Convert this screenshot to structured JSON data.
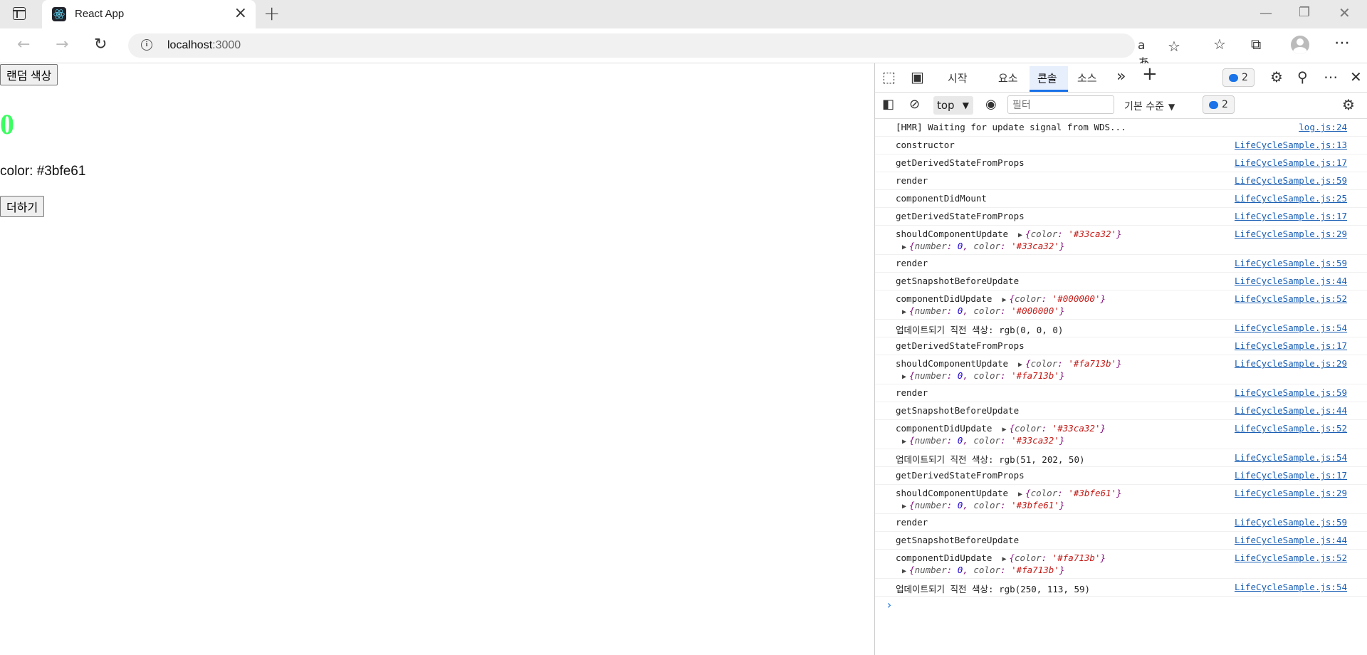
{
  "browser": {
    "tab_title": "React App",
    "url_host": "localhost",
    "url_port": ":3000"
  },
  "page": {
    "random_color_button": "랜덤 색상",
    "counter_value": "0",
    "counter_color": "#3bfe61",
    "color_label": "color: #3bfe61",
    "add_button": "더하기"
  },
  "devtools": {
    "tabs": [
      "시작",
      "요소",
      "콘솔",
      "소스"
    ],
    "active_tab": "콘솔",
    "issues_count": "2",
    "context": "top",
    "filter_placeholder": "필터",
    "levels": "기본 수준",
    "toolbar_issues_count": "2"
  },
  "console_rows": [
    {
      "msg": "[HMR] Waiting for update signal from WDS...",
      "src": "log.js:24"
    },
    {
      "msg": "constructor",
      "src": "LifeCycleSample.js:13"
    },
    {
      "msg": "getDerivedStateFromProps",
      "src": "LifeCycleSample.js:17"
    },
    {
      "msg": "render",
      "src": "LifeCycleSample.js:59"
    },
    {
      "msg": "componentDidMount",
      "src": "LifeCycleSample.js:25"
    },
    {
      "msg": "getDerivedStateFromProps",
      "src": "LifeCycleSample.js:17"
    },
    {
      "msg": "shouldComponentUpdate",
      "obj1": "{color: '#33ca32'}",
      "obj2": "{number: 0, color: '#33ca32'}",
      "src": "LifeCycleSample.js:29"
    },
    {
      "msg": "render",
      "src": "LifeCycleSample.js:59"
    },
    {
      "msg": "getSnapshotBeforeUpdate",
      "src": "LifeCycleSample.js:44"
    },
    {
      "msg": "componentDidUpdate",
      "obj1": "{color: '#000000'}",
      "obj2": "{number: 0, color: '#000000'}",
      "src": "LifeCycleSample.js:52"
    },
    {
      "msg": "업데이트되기 직전 색상:  rgb(0, 0, 0)",
      "src": "LifeCycleSample.js:54"
    },
    {
      "msg": "getDerivedStateFromProps",
      "src": "LifeCycleSample.js:17"
    },
    {
      "msg": "shouldComponentUpdate",
      "obj1": "{color: '#fa713b'}",
      "obj2": "{number: 0, color: '#fa713b'}",
      "src": "LifeCycleSample.js:29"
    },
    {
      "msg": "render",
      "src": "LifeCycleSample.js:59"
    },
    {
      "msg": "getSnapshotBeforeUpdate",
      "src": "LifeCycleSample.js:44"
    },
    {
      "msg": "componentDidUpdate",
      "obj1": "{color: '#33ca32'}",
      "obj2": "{number: 0, color: '#33ca32'}",
      "src": "LifeCycleSample.js:52"
    },
    {
      "msg": "업데이트되기 직전 색상:  rgb(51, 202, 50)",
      "src": "LifeCycleSample.js:54"
    },
    {
      "msg": "getDerivedStateFromProps",
      "src": "LifeCycleSample.js:17"
    },
    {
      "msg": "shouldComponentUpdate",
      "obj1": "{color: '#3bfe61'}",
      "obj2": "{number: 0, color: '#3bfe61'}",
      "src": "LifeCycleSample.js:29"
    },
    {
      "msg": "render",
      "src": "LifeCycleSample.js:59"
    },
    {
      "msg": "getSnapshotBeforeUpdate",
      "src": "LifeCycleSample.js:44"
    },
    {
      "msg": "componentDidUpdate",
      "obj1": "{color: '#fa713b'}",
      "obj2": "{number: 0, color: '#fa713b'}",
      "src": "LifeCycleSample.js:52"
    },
    {
      "msg": "업데이트되기 직전 색상:  rgb(250, 113, 59)",
      "src": "LifeCycleSample.js:54"
    }
  ],
  "colors": {
    "link": "#1a5fb4",
    "accent": "#1a73e8"
  }
}
